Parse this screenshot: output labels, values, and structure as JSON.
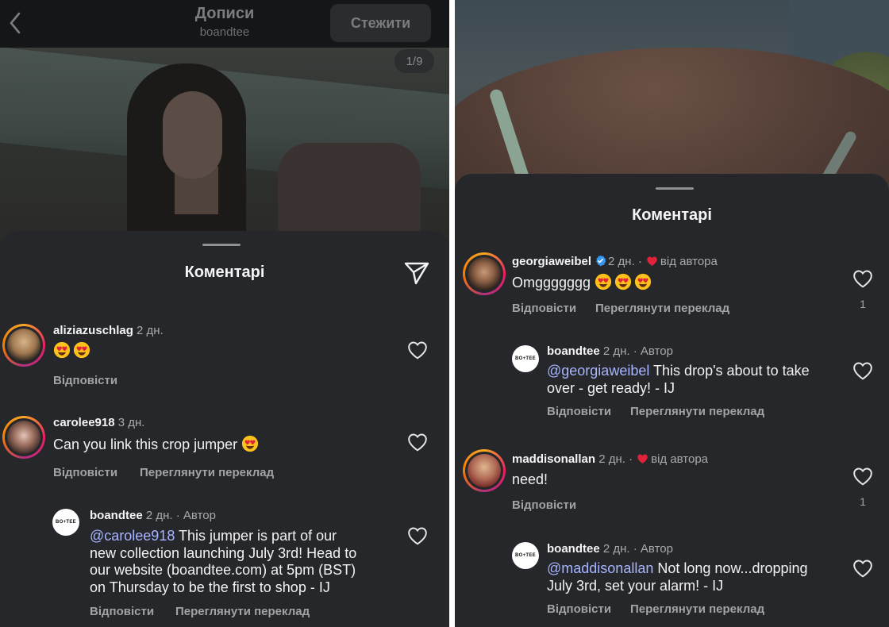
{
  "left": {
    "header": {
      "title": "Дописи",
      "subtitle": "boandtee",
      "follow_label": "Стежити",
      "photo_counter": "1/9"
    },
    "sheet_title": "Коментарі",
    "comments": [
      {
        "username": "aliziazuschlag",
        "time": "2 дн.",
        "text": "",
        "emoji_count": 2,
        "reply_label": "Відповісти"
      },
      {
        "username": "carolee918",
        "time": "3 дн.",
        "text": "Can you link this crop jumper",
        "emoji_count": 1,
        "reply_label": "Відповісти",
        "translate_label": "Переглянути переклад"
      },
      {
        "username": "boandtee",
        "time": "2 дн.",
        "author_label": "Автор",
        "mention": "@carolee918",
        "lines": [
          "This jumper is part of our",
          "new collection launching July 3rd! Head to",
          "our website (boandtee.com) at 5pm (BST)",
          "on Thursday to be the first to shop - IJ"
        ],
        "reply_label": "Відповісти",
        "translate_label": "Переглянути переклад"
      }
    ]
  },
  "right": {
    "sheet_title": "Коментарі",
    "comments": [
      {
        "username": "georgiaweibel",
        "time": "2 дн.",
        "liked_by_author": "від автора",
        "text": "Omggggggg",
        "emoji_count": 3,
        "likes": "1",
        "reply_label": "Відповісти",
        "translate_label": "Переглянути переклад"
      },
      {
        "username": "boandtee",
        "time": "2 дн.",
        "author_label": "Автор",
        "mention": "@georgiaweibel",
        "lines": [
          "This drop's about to take",
          "over - get ready! - IJ"
        ],
        "reply_label": "Відповісти",
        "translate_label": "Переглянути переклад"
      },
      {
        "username": "maddisonallan",
        "time": "2 дн.",
        "liked_by_author": "від автора",
        "text": "need!",
        "likes": "1",
        "reply_label": "Відповісти"
      },
      {
        "username": "boandtee",
        "time": "2 дн.",
        "author_label": "Автор",
        "mention": "@maddisonallan",
        "lines": [
          "Not long now...dropping",
          "July 3rd, set your alarm! - IJ"
        ],
        "reply_label": "Відповісти",
        "translate_label": "Переглянути переклад"
      }
    ]
  },
  "brand_avatar_text": "BO+TEE",
  "colors": {
    "background": "#25272b",
    "mention": "#a8b5ff",
    "heart_red": "#e0223a",
    "verified_blue": "#3897f0"
  },
  "icons": [
    "back-chevron-icon",
    "share-icon",
    "heart-outline-icon",
    "heart-filled-icon",
    "verified-badge-icon",
    "smiling-face-with-heart-eyes-emoji"
  ]
}
